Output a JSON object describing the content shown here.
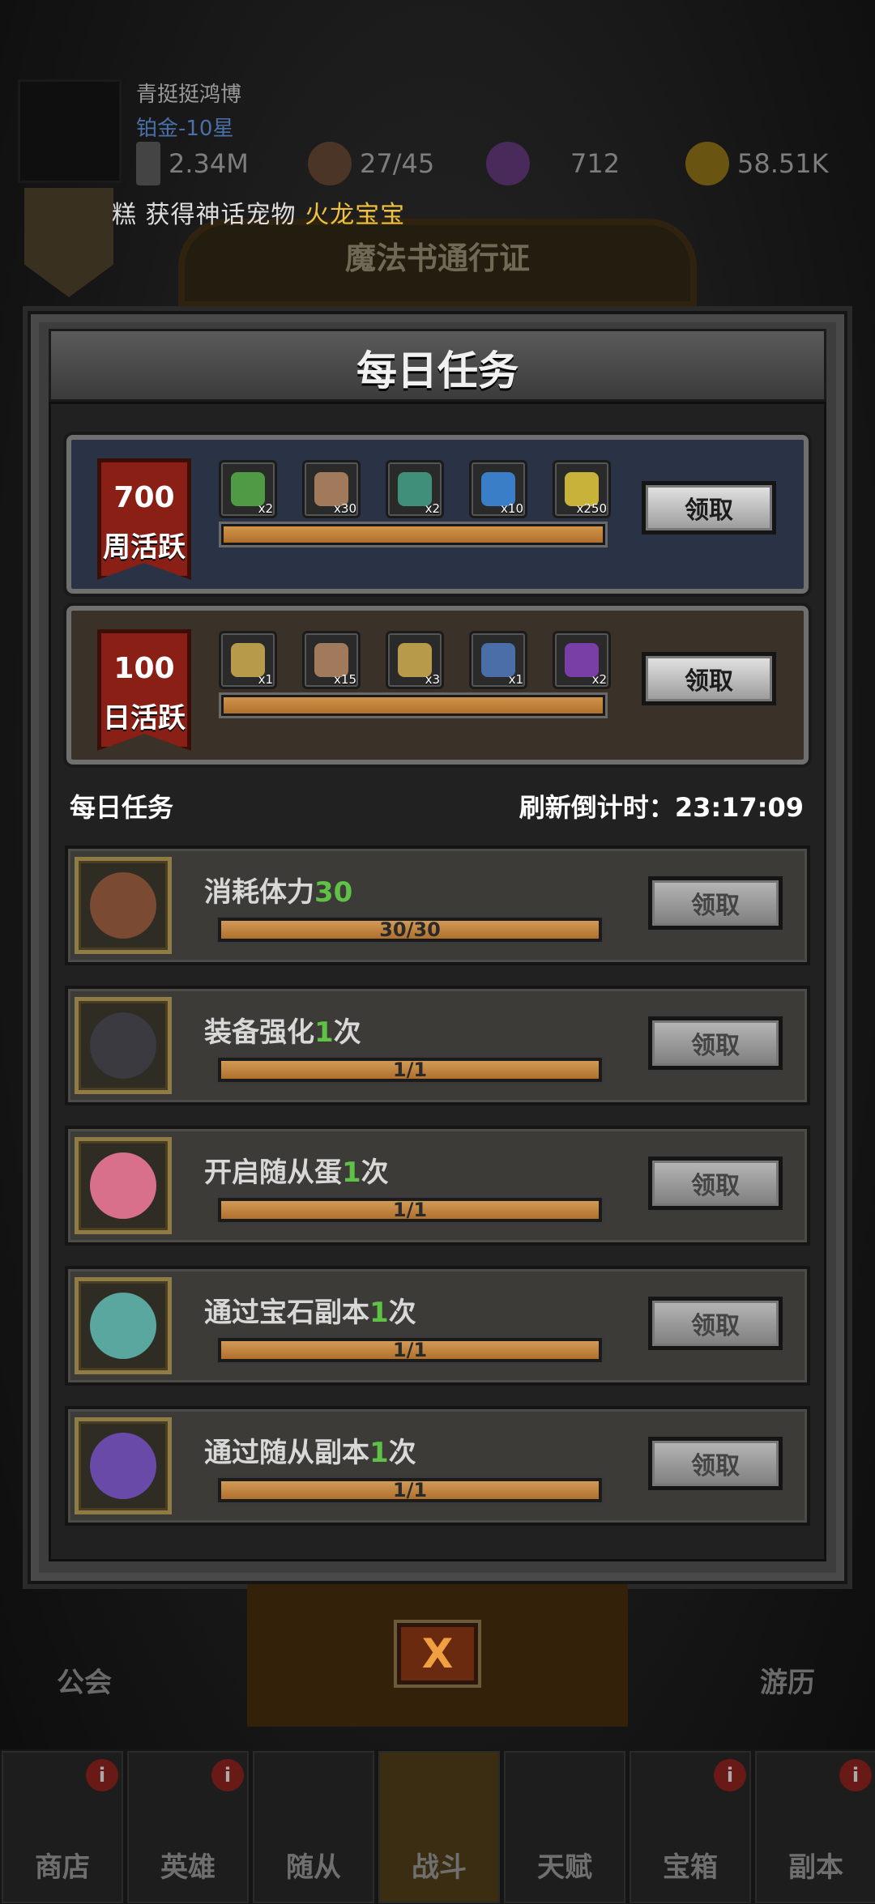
{
  "player": {
    "name": "青挺挺鸿博",
    "rank": "铂金-10星"
  },
  "resources": {
    "power": "2.34M",
    "stamina": "27/45",
    "gems": "712",
    "gold": "58.51K"
  },
  "ticker": {
    "prefix": "糕",
    "middle": "获得神话宠物",
    "highlight": "火龙宝宝"
  },
  "pass_title": "魔法书通行证",
  "dialog": {
    "title": "每日任务",
    "weekly": {
      "points": "700",
      "label": "周活跃",
      "button": "领取",
      "progress": 1.0,
      "items": [
        {
          "icon": "green-chest-icon",
          "color": "#4e9a45",
          "count": "x2"
        },
        {
          "icon": "meat-icon",
          "color": "#a07a5a",
          "count": "x30"
        },
        {
          "icon": "teal-chest-icon",
          "color": "#3f8f7a",
          "count": "x2"
        },
        {
          "icon": "blue-card-icon",
          "color": "#3a7ec8",
          "count": "x10"
        },
        {
          "icon": "gem-icon",
          "color": "#c9b23a",
          "count": "x250"
        }
      ]
    },
    "daily": {
      "points": "100",
      "label": "日活跃",
      "button": "领取",
      "progress": 1.0,
      "items": [
        {
          "icon": "gold-chest-icon",
          "color": "#b79a4a",
          "count": "x1"
        },
        {
          "icon": "meat-icon",
          "color": "#a07a5a",
          "count": "x15"
        },
        {
          "icon": "gold-chest-icon",
          "color": "#b79a4a",
          "count": "x3"
        },
        {
          "icon": "blue-chest-icon",
          "color": "#4a6ea8",
          "count": "x1"
        },
        {
          "icon": "hero-portrait-icon",
          "color": "#7a3fa6",
          "count": "x2"
        }
      ]
    },
    "section_title": "每日任务",
    "refresh_label": "刷新倒计时：",
    "refresh_time": "23:17:09",
    "tasks": [
      {
        "icon": "meat-icon",
        "text": "消耗体力",
        "count": "30",
        "suffix": "",
        "progress": "30/30",
        "button": "领取"
      },
      {
        "icon": "helmet-icon",
        "text": "装备强化",
        "count": "1",
        "suffix": "次",
        "progress": "1/1",
        "button": "领取"
      },
      {
        "icon": "egg-icon",
        "text": "开启随从蛋",
        "count": "1",
        "suffix": "次",
        "progress": "1/1",
        "button": "领取"
      },
      {
        "icon": "gem-ticket-icon",
        "text": "通过宝石副本",
        "count": "1",
        "suffix": "次",
        "progress": "1/1",
        "button": "领取"
      },
      {
        "icon": "pet-ticket-icon",
        "text": "通过随从副本",
        "count": "1",
        "suffix": "次",
        "progress": "1/1",
        "button": "领取"
      }
    ]
  },
  "close_label": "X",
  "side": {
    "left": "公会",
    "right": "游历"
  },
  "nav": [
    {
      "label": "商店",
      "badge": "i"
    },
    {
      "label": "英雄",
      "badge": "i"
    },
    {
      "label": "随从",
      "badge": ""
    },
    {
      "label": "战斗",
      "badge": ""
    },
    {
      "label": "天赋",
      "badge": ""
    },
    {
      "label": "宝箱",
      "badge": "i"
    },
    {
      "label": "副本",
      "badge": "i"
    }
  ],
  "colors": {
    "accent_green": "#5fc146",
    "bar_fill": "#c4843e",
    "gold": "#f0c23c"
  }
}
